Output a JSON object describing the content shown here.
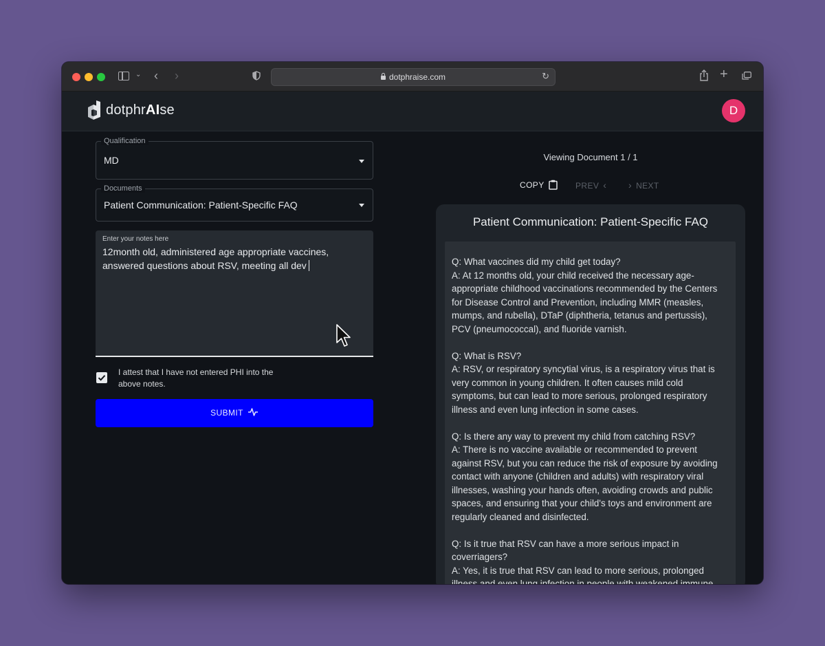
{
  "browser": {
    "url": "dotphraise.com"
  },
  "app": {
    "logo_prefix": "dotphr",
    "logo_bold": "AI",
    "logo_suffix": "se",
    "avatar_initial": "D",
    "avatar_color": "#e5336b"
  },
  "form": {
    "qualification_label": "Qualification",
    "qualification_value": "MD",
    "documents_label": "Documents",
    "documents_value": "Patient Communication: Patient-Specific FAQ",
    "notes_label": "Enter your notes here",
    "notes_value": "12month old, administered age appropriate vaccines, answered questions about RSV, meeting all dev",
    "attest_text": "I attest that I have not entered PHI into the above notes.",
    "attest_checked": true,
    "submit_label": "SUBMIT",
    "submit_color": "#0000ff"
  },
  "viewer": {
    "viewing_label": "Viewing Document 1 / 1",
    "copy_label": "COPY",
    "prev_label": "PREV",
    "next_label": "NEXT",
    "doc_title": "Patient Communication: Patient-Specific FAQ",
    "doc_paragraphs": [
      "Q: What vaccines did my child get today?\nA: At 12 months old, your child received the necessary age-appropriate childhood vaccinations recommended by the Centers for Disease Control and Prevention, including MMR (measles, mumps, and rubella), DTaP (diphtheria, tetanus and pertussis), PCV (pneumococcal), and fluoride varnish.",
      "Q: What is RSV?\nA: RSV, or respiratory syncytial virus, is a respiratory virus that is very common in young children. It often causes mild cold symptoms, but can lead to more serious, prolonged respiratory illness and even lung infection in some cases.",
      "Q: Is there any way to prevent my child from catching RSV?\nA: There is no vaccine available or recommended to prevent against RSV, but you can reduce the risk of exposure by avoiding contact with anyone (children and adults) with respiratory viral illnesses, washing your hands often, avoiding crowds and public spaces, and ensuring that your child's toys and environment are regularly cleaned and disinfected.",
      "Q: Is it true that RSV can have a more serious impact in coverriagers?\nA: Yes, it is true that RSV can lead to more serious, prolonged illness and even lung infection in people with weakened immune"
    ]
  }
}
